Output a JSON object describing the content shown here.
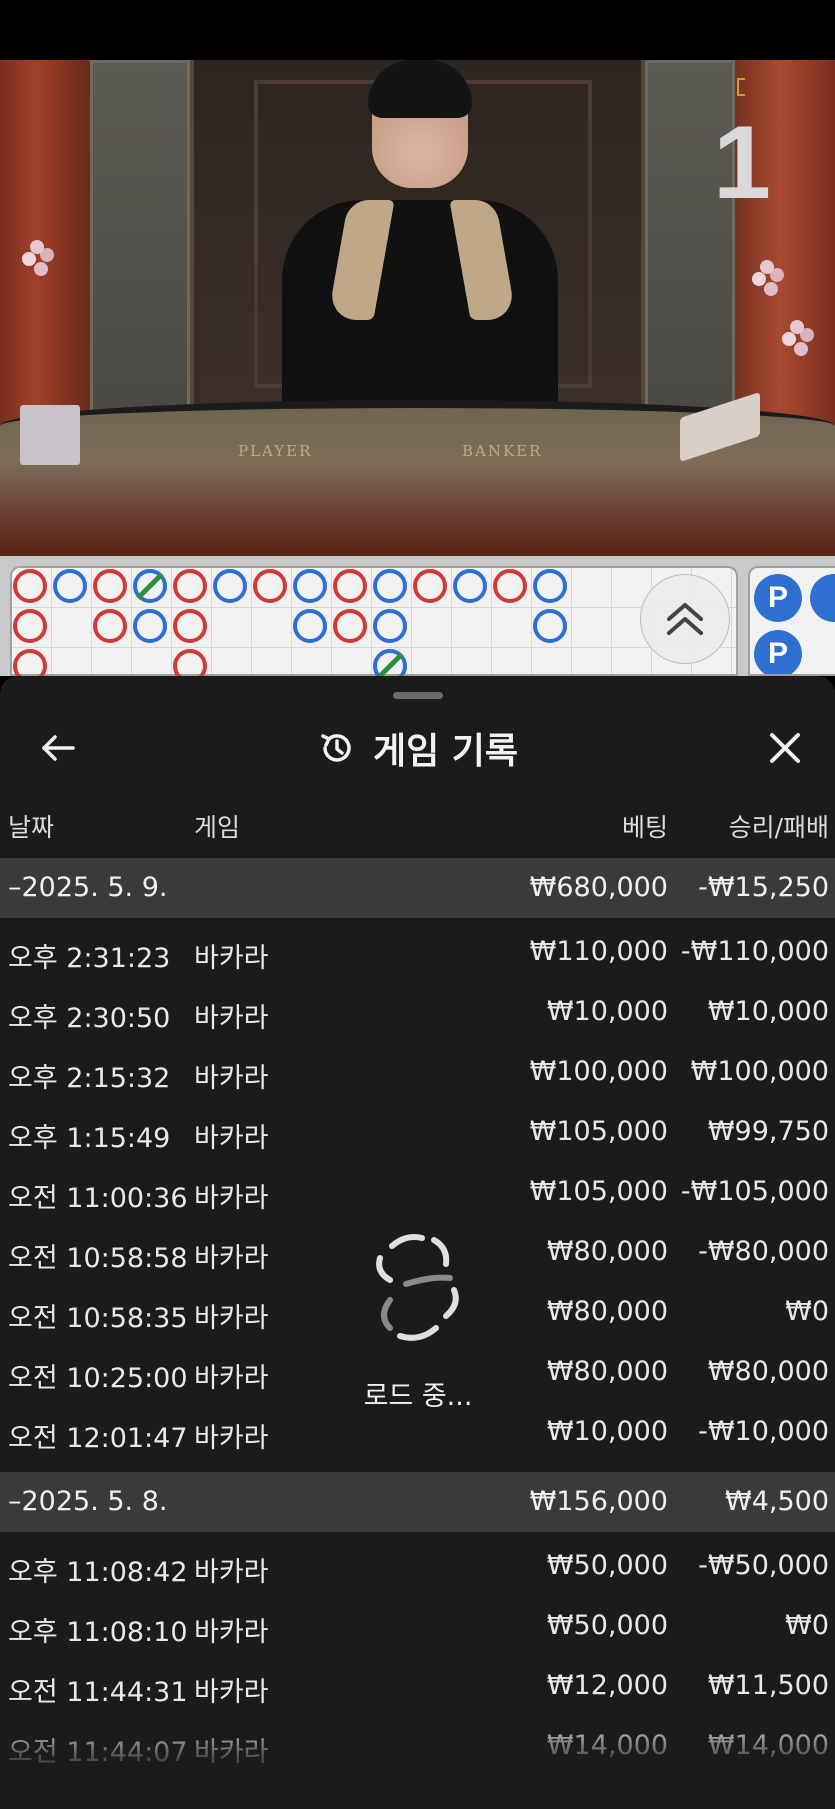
{
  "video": {
    "table_player_label": "PLAYER",
    "table_banker_label": "BANKER",
    "table_number": "1"
  },
  "roadmap": {
    "colors": {
      "banker": "#d23a3a",
      "player": "#2e6fd1",
      "tie": "#2f8f3a"
    },
    "side_badges": [
      "P",
      "P"
    ],
    "expand_icon": "double-chevron-up-icon"
  },
  "sheet": {
    "title": "게임 기록",
    "title_icon": "history-icon",
    "back_icon": "arrow-left-icon",
    "close_icon": "close-icon",
    "columns": {
      "date": "날짜",
      "game": "게임",
      "bet": "베팅",
      "win_loss": "승리/패배"
    },
    "loading_text": "로드 중...",
    "groups": [
      {
        "date": "–2025. 5. 9.",
        "bet_total": "₩680,000",
        "win_loss_total": "-₩15,250",
        "rows": [
          {
            "time": "오후 2:31:23",
            "game": "바카라",
            "bet": "₩110,000",
            "win_loss": "-₩110,000"
          },
          {
            "time": "오후 2:30:50",
            "game": "바카라",
            "bet": "₩10,000",
            "win_loss": "₩10,000"
          },
          {
            "time": "오후 2:15:32",
            "game": "바카라",
            "bet": "₩100,000",
            "win_loss": "₩100,000"
          },
          {
            "time": "오후 1:15:49",
            "game": "바카라",
            "bet": "₩105,000",
            "win_loss": "₩99,750"
          },
          {
            "time": "오전 11:00:36",
            "game": "바카라",
            "bet": "₩105,000",
            "win_loss": "-₩105,000"
          },
          {
            "time": "오전 10:58:58",
            "game": "바카라",
            "bet": "₩80,000",
            "win_loss": "-₩80,000"
          },
          {
            "time": "오전 10:58:35",
            "game": "바카라",
            "bet": "₩80,000",
            "win_loss": "₩0"
          },
          {
            "time": "오전 10:25:00",
            "game": "바카라",
            "bet": "₩80,000",
            "win_loss": "₩80,000"
          },
          {
            "time": "오전 12:01:47",
            "game": "바카라",
            "bet": "₩10,000",
            "win_loss": "-₩10,000"
          }
        ]
      },
      {
        "date": "–2025. 5. 8.",
        "bet_total": "₩156,000",
        "win_loss_total": "₩4,500",
        "rows": [
          {
            "time": "오후 11:08:42",
            "game": "바카라",
            "bet": "₩50,000",
            "win_loss": "-₩50,000"
          },
          {
            "time": "오후 11:08:10",
            "game": "바카라",
            "bet": "₩50,000",
            "win_loss": "₩0"
          },
          {
            "time": "오전 11:44:31",
            "game": "바카라",
            "bet": "₩12,000",
            "win_loss": "₩11,500"
          },
          {
            "time": "오전 11:44:07",
            "game": "바카라",
            "bet": "₩14,000",
            "win_loss": "₩14,000"
          }
        ]
      }
    ]
  }
}
